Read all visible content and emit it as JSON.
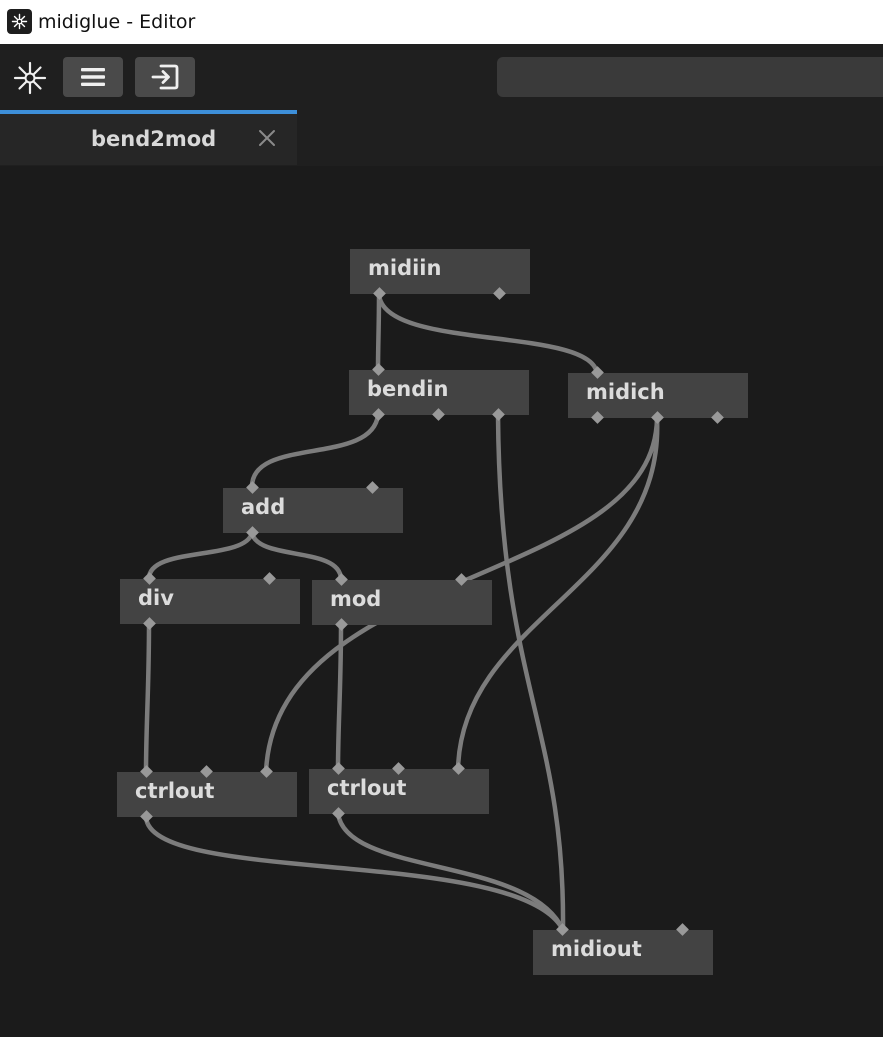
{
  "window": {
    "title": "midiglue - Editor"
  },
  "toolbar": {
    "search": {
      "value": "",
      "placeholder": ""
    },
    "buttons": [
      {
        "icon": "hamburger-menu-icon"
      },
      {
        "icon": "import-icon"
      }
    ]
  },
  "tabs": [
    {
      "label": "bend2mod",
      "active": true
    }
  ],
  "colors": {
    "tab_accent": "#3d8fd9",
    "node": "#434343",
    "wire": "#7c7c7c",
    "port": "#999999",
    "canvas": "#1b1b1b"
  },
  "graph": {
    "nodes": [
      {
        "id": "midiin",
        "label": "midiin"
      },
      {
        "id": "bendin",
        "label": "bendin"
      },
      {
        "id": "midich",
        "label": "midich"
      },
      {
        "id": "add",
        "label": "add"
      },
      {
        "id": "div",
        "label": "div"
      },
      {
        "id": "mod",
        "label": "mod"
      },
      {
        "id": "ctrlout1",
        "label": "ctrlout"
      },
      {
        "id": "ctrlout2",
        "label": "ctrlout"
      },
      {
        "id": "midiout",
        "label": "midiout"
      }
    ],
    "edges": [
      {
        "from": "midiin",
        "to": "bendin"
      },
      {
        "from": "midiin",
        "to": "midich"
      },
      {
        "from": "bendin",
        "to": "add"
      },
      {
        "from": "bendin",
        "to": "midiout"
      },
      {
        "from": "add",
        "to": "div"
      },
      {
        "from": "add",
        "to": "mod"
      },
      {
        "from": "midich",
        "to": "ctrlout1"
      },
      {
        "from": "midich",
        "to": "ctrlout2"
      },
      {
        "from": "div",
        "to": "ctrlout1"
      },
      {
        "from": "mod",
        "to": "ctrlout2"
      },
      {
        "from": "ctrlout1",
        "to": "midiout"
      },
      {
        "from": "ctrlout2",
        "to": "midiout"
      }
    ]
  }
}
